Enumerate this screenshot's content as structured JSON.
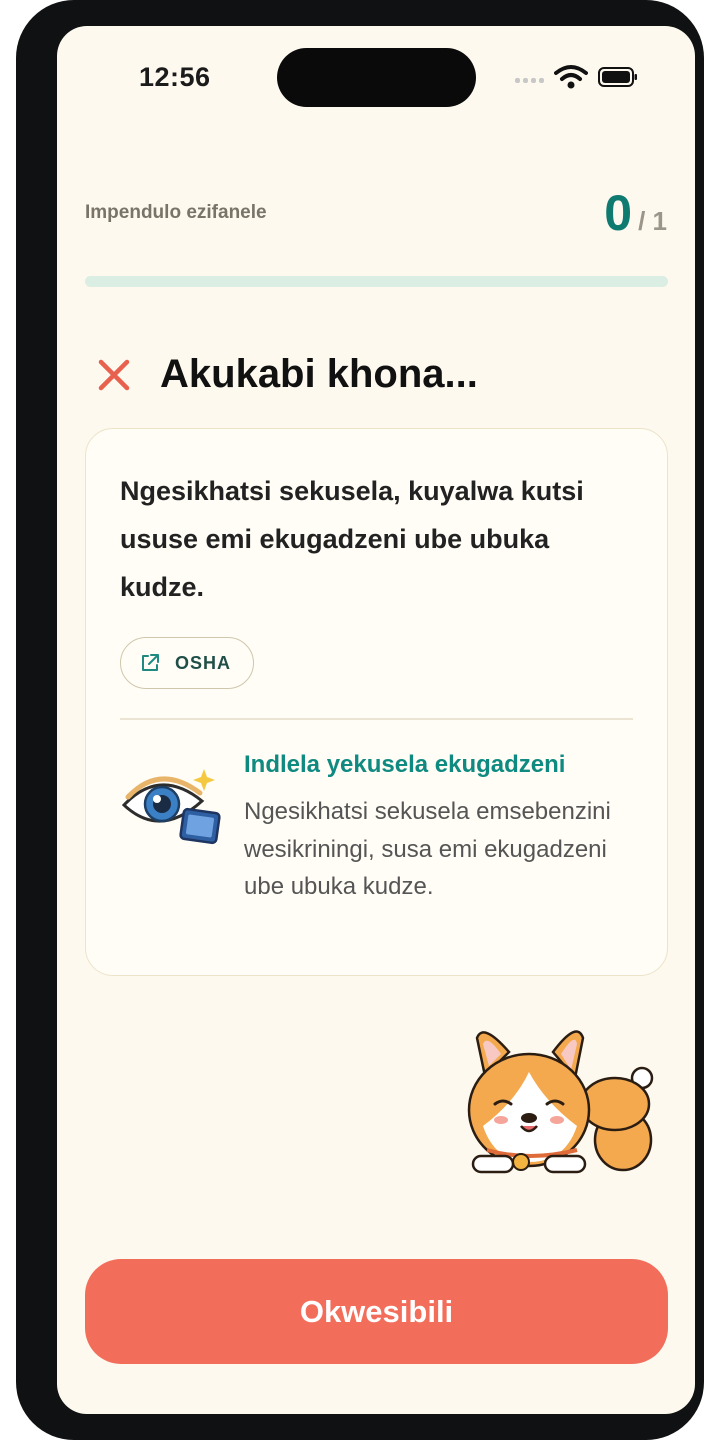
{
  "status_bar": {
    "time": "12:56"
  },
  "score": {
    "label": "Impendulo ezifanele",
    "value": "0",
    "total": "/ 1",
    "progress": 0
  },
  "result": {
    "title": "Akukabi khona..."
  },
  "card": {
    "text": "Ngesikhatsi sekusela, kuyalwa kutsi ususe emi ekugadzeni ube ubuka kudze.",
    "source_button": "OSHA",
    "tip": {
      "title": "Indlela yekusela ekugadzeni",
      "body": "Ngesikhatsi sekusela emsebenzini wesikriningi, susa emi ekugadzeni ube ubuka kudze."
    }
  },
  "cta": {
    "label": "Okwesibili"
  },
  "colors": {
    "accent": "#0f7a70",
    "error": "#e8604e",
    "cta": "#f26d5a",
    "background": "#fdf9ef"
  }
}
